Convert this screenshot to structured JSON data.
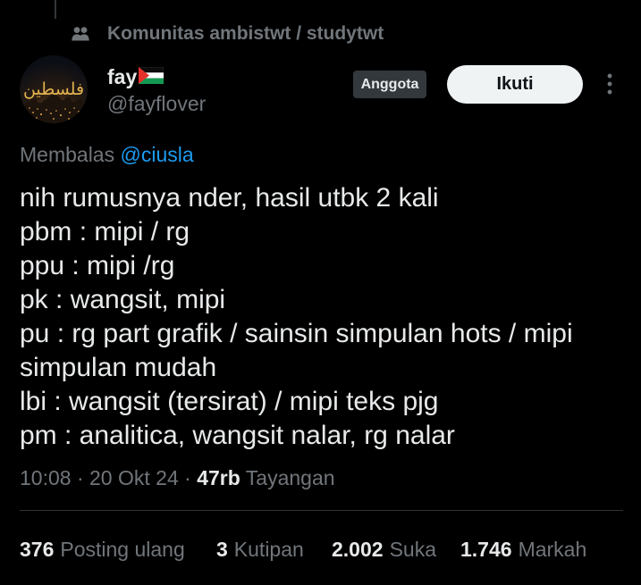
{
  "community": {
    "label": "Komunitas ambistwt / studytwt",
    "icon": "community-icon"
  },
  "author": {
    "display_name": "fay",
    "name_emoji_icon": "palestine-flag-icon",
    "handle": "@fayflover",
    "badge": "Anggota",
    "avatar_calligraphy": "فلسطين"
  },
  "actions": {
    "follow_label": "Ikuti",
    "more_icon": "more-options-icon"
  },
  "reply": {
    "prefix": "Membalas",
    "handle": "@ciusla"
  },
  "tweet": {
    "lines": [
      "nih rumusnya nder, hasil utbk 2 kali",
      "pbm : mipi / rg",
      "ppu : mipi /rg",
      "pk : wangsit, mipi",
      "pu : rg part grafik / sainsin simpulan hots / mipi simpulan mudah",
      "lbi : wangsit (tersirat) / mipi teks pjg",
      "pm : analitica, wangsit nalar, rg nalar"
    ]
  },
  "meta": {
    "time": "10:08",
    "separator": "·",
    "date": "20 Okt 24",
    "views_count": "47rb",
    "views_label": "Tayangan"
  },
  "stats": [
    {
      "count": "376",
      "label": "Posting ulang"
    },
    {
      "count": "3",
      "label": "Kutipan"
    },
    {
      "count": "2.002",
      "label": "Suka"
    },
    {
      "count": "1.746",
      "label": "Markah"
    }
  ],
  "colors": {
    "background": "#000000",
    "text": "#e7e9ea",
    "muted": "#71767b",
    "link": "#1d9bf0",
    "follow_button": "#eff3f4",
    "badge_background": "#33383c",
    "divider": "#2f3336"
  }
}
